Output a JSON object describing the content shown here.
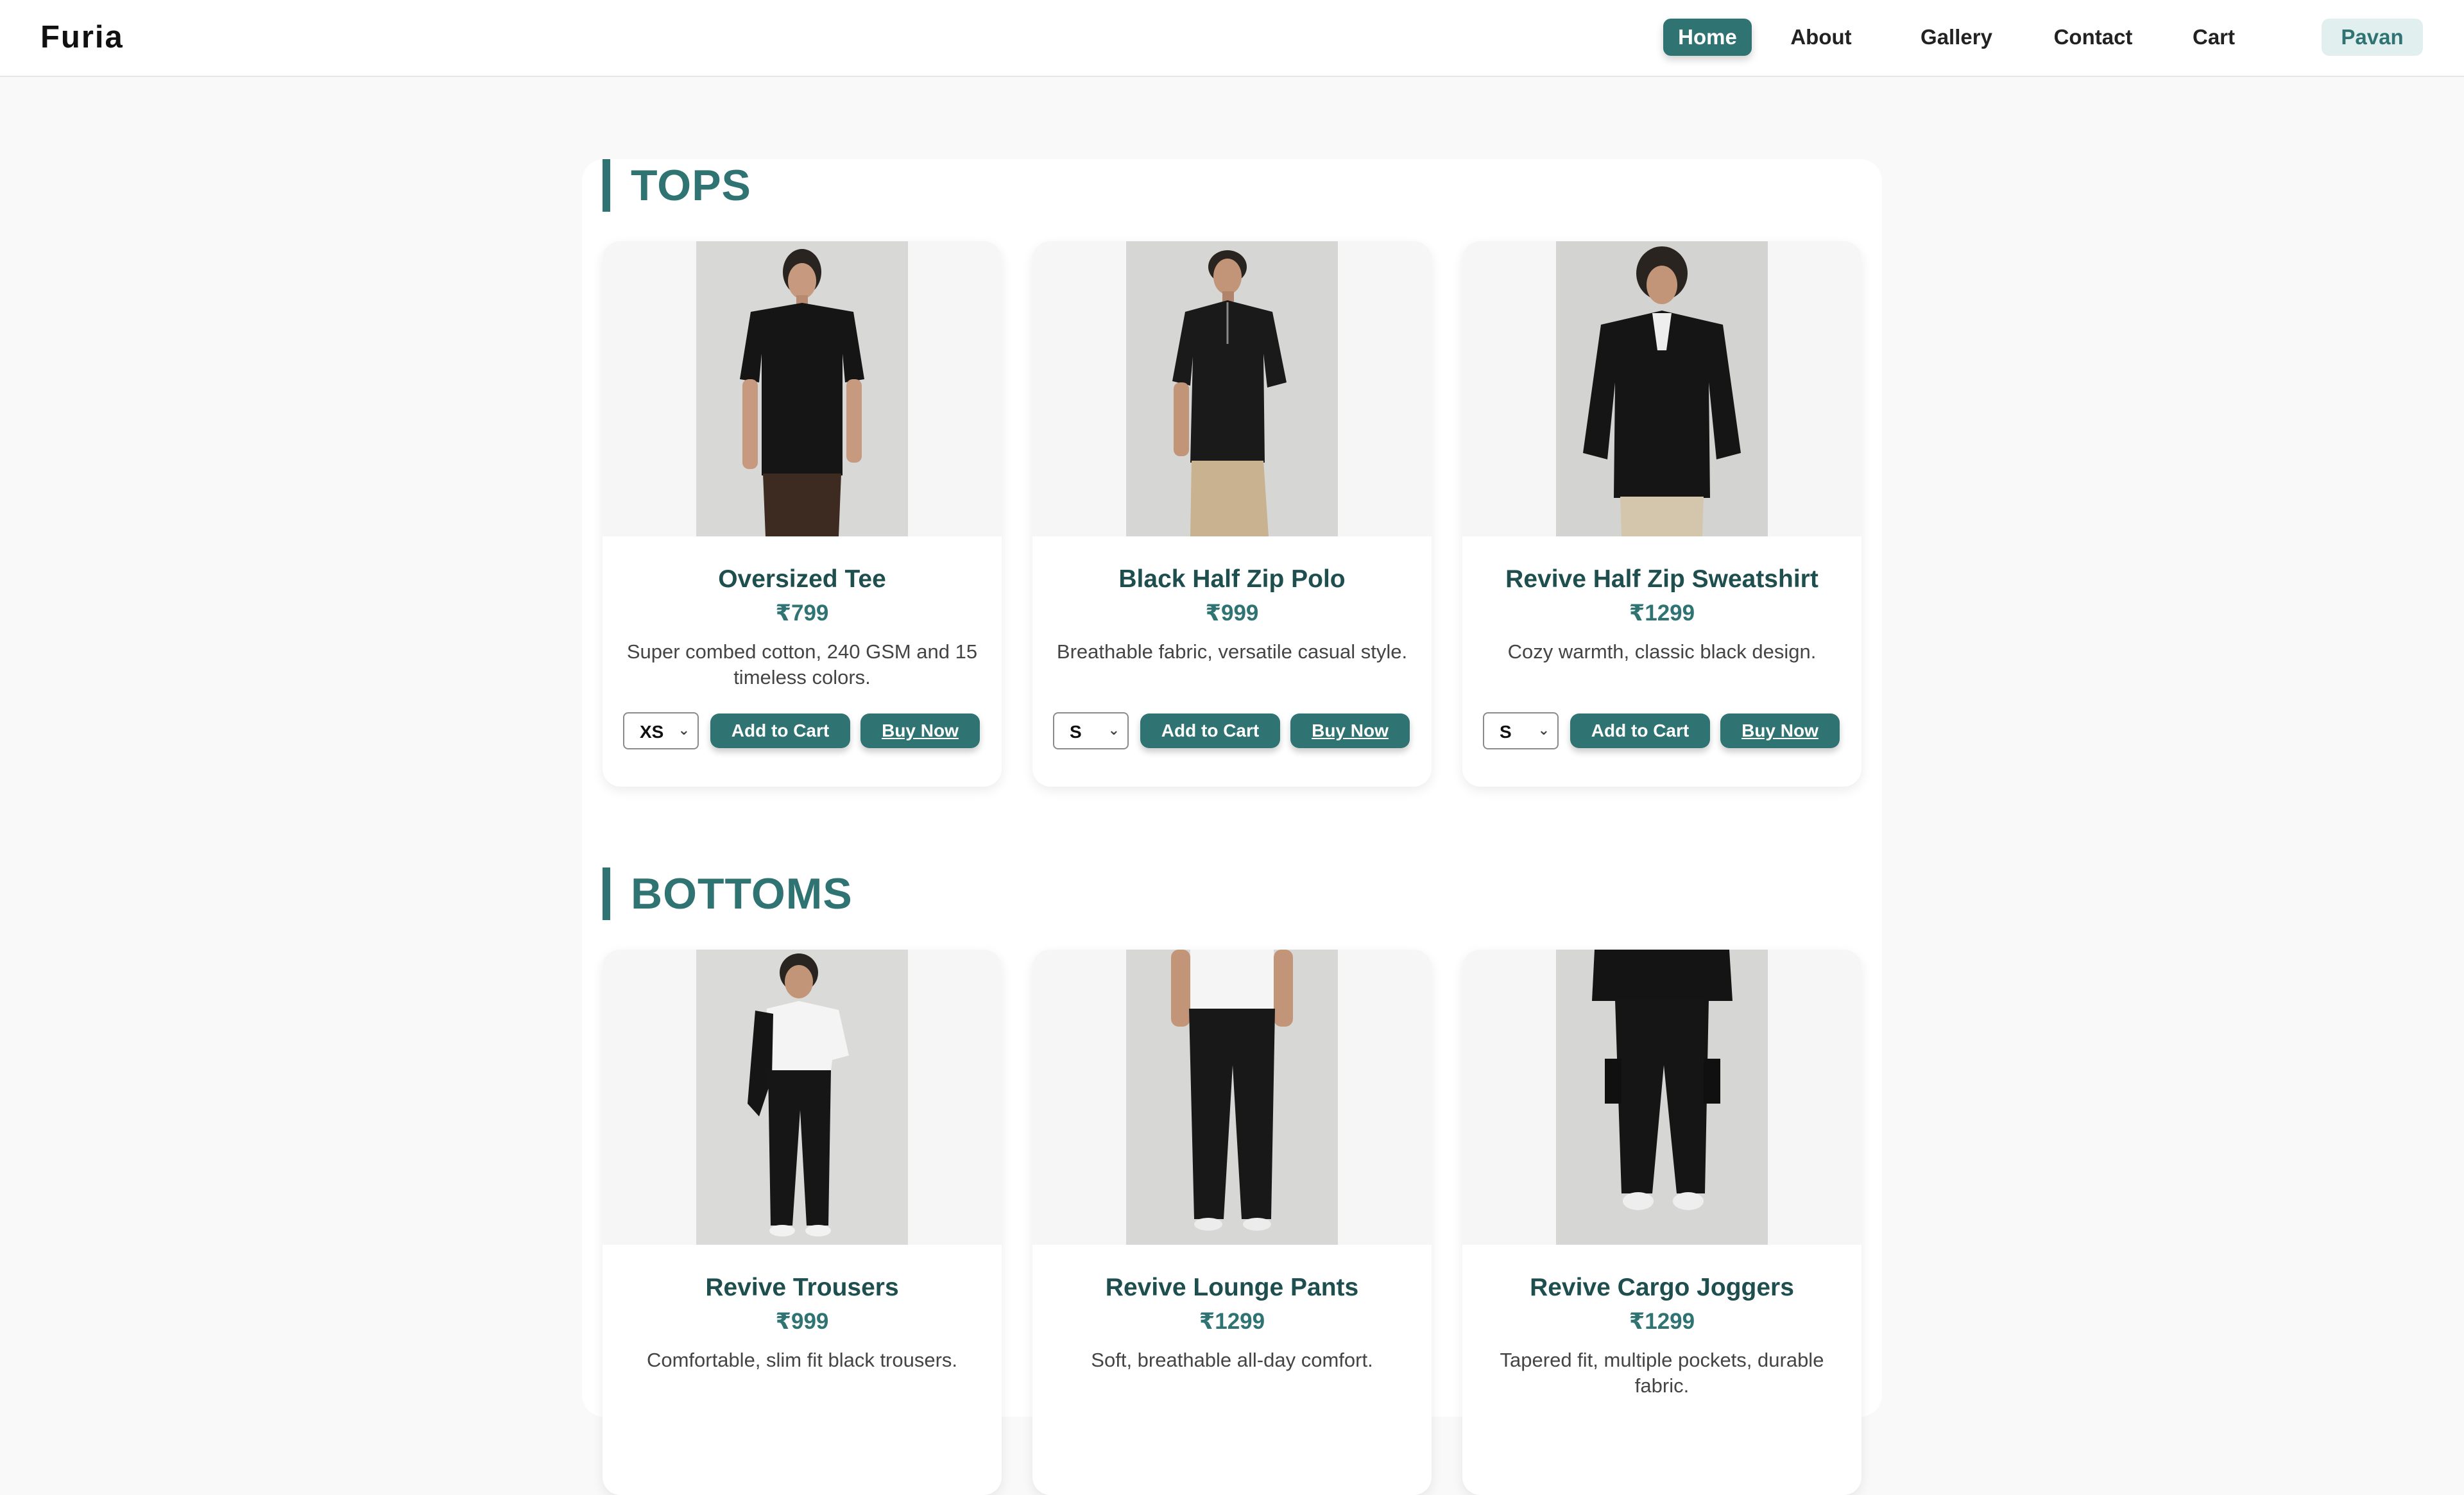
{
  "header": {
    "brand": "Furia",
    "nav": {
      "home": "Home",
      "about": "About",
      "gallery": "Gallery",
      "contact": "Contact",
      "cart": "Cart",
      "user": "Pavan"
    }
  },
  "sections": {
    "tops": {
      "title": "TOPS",
      "products": [
        {
          "name": "Oversized Tee",
          "price": "₹799",
          "description": "Super combed cotton, 240 GSM and 15 timeless colors.",
          "size": "XS",
          "add_to_cart": "Add to Cart",
          "buy_now": "Buy Now"
        },
        {
          "name": "Black Half Zip Polo",
          "price": "₹999",
          "description": "Breathable fabric, versatile casual style.",
          "size": "S",
          "add_to_cart": "Add to Cart",
          "buy_now": "Buy Now"
        },
        {
          "name": "Revive Half Zip Sweatshirt",
          "price": "₹1299",
          "description": "Cozy warmth, classic black design.",
          "size": "S",
          "add_to_cart": "Add to Cart",
          "buy_now": "Buy Now"
        }
      ]
    },
    "bottoms": {
      "title": "BOTTOMS",
      "products": [
        {
          "name": "Revive Trousers",
          "price": "₹999",
          "description": "Comfortable, slim fit black trousers."
        },
        {
          "name": "Revive Lounge Pants",
          "price": "₹1299",
          "description": "Soft, breathable all-day comfort."
        },
        {
          "name": "Revive Cargo Joggers",
          "price": "₹1299",
          "description": "Tapered fit, multiple pockets, durable fabric."
        }
      ]
    }
  },
  "colors": {
    "accent": "#2f7373",
    "product_name": "#1f4e4e",
    "user_chip_bg": "#e2efef",
    "page_bg": "#f9f9f9"
  },
  "icons": {
    "select_chevron": "chevron-down-icon"
  }
}
